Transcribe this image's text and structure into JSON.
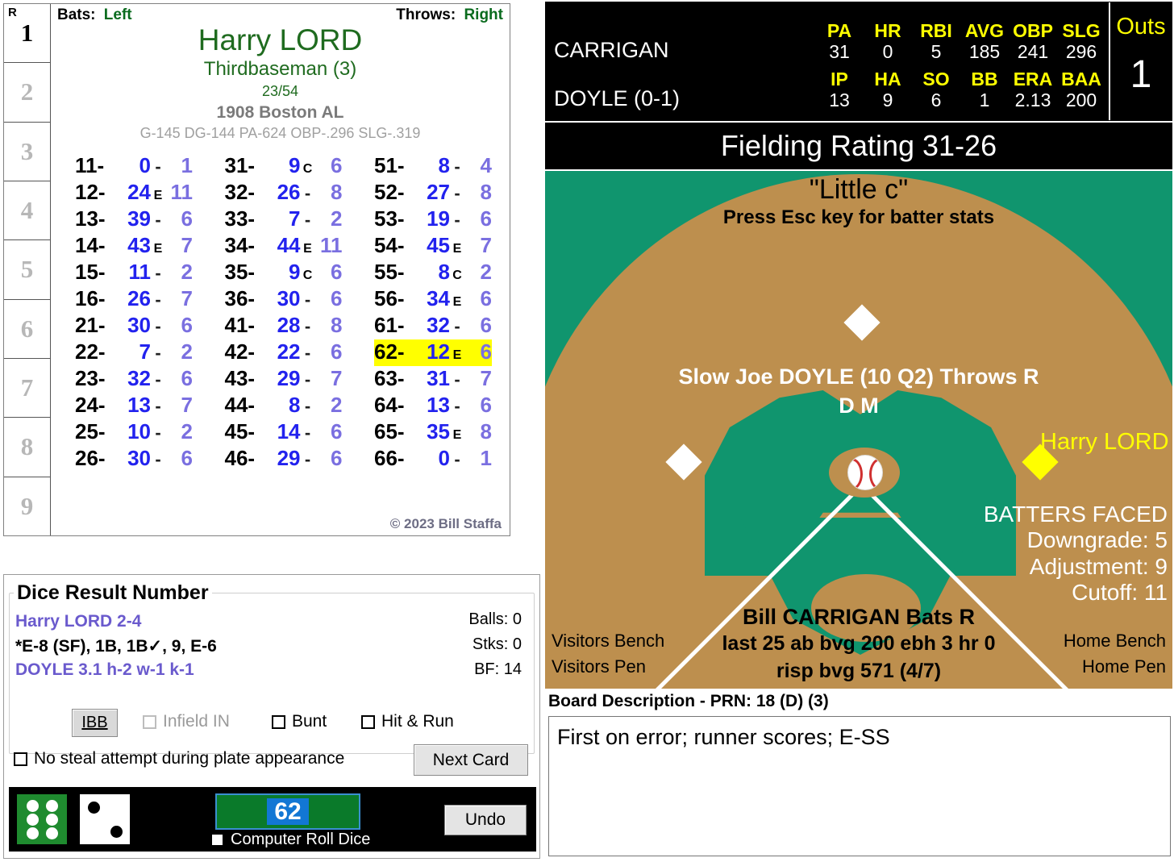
{
  "card": {
    "innings": [
      "1",
      "2",
      "3",
      "4",
      "5",
      "6",
      "7",
      "8",
      "9"
    ],
    "runs_label": "R",
    "bats_label": "Bats:",
    "bats_value": "Left",
    "throws_label": "Throws:",
    "throws_value": "Right",
    "player_name": "Harry LORD",
    "position": "Thirdbaseman (3)",
    "fraction": "23/54",
    "team_year": "1908 Boston AL",
    "stat_line": "G-145 DG-144 PA-624 OBP-.296 SLG-.319",
    "copyright": "© 2023 Bill Staffa",
    "highlight_key": "62-",
    "columns": [
      [
        {
          "key": "11-",
          "num": "0",
          "mid": "-",
          "tail": "1"
        },
        {
          "key": "12-",
          "num": "24",
          "mid": "E",
          "tail": "11"
        },
        {
          "key": "13-",
          "num": "39",
          "mid": "-",
          "tail": "6"
        },
        {
          "key": "14-",
          "num": "43",
          "mid": "E",
          "tail": "7"
        },
        {
          "key": "15-",
          "num": "11",
          "mid": "-",
          "tail": "2"
        },
        {
          "key": "16-",
          "num": "26",
          "mid": "-",
          "tail": "7"
        },
        {
          "key": "21-",
          "num": "30",
          "mid": "-",
          "tail": "6"
        },
        {
          "key": "22-",
          "num": "7",
          "mid": "-",
          "tail": "2"
        },
        {
          "key": "23-",
          "num": "32",
          "mid": "-",
          "tail": "6"
        },
        {
          "key": "24-",
          "num": "13",
          "mid": "-",
          "tail": "7"
        },
        {
          "key": "25-",
          "num": "10",
          "mid": "-",
          "tail": "2"
        },
        {
          "key": "26-",
          "num": "30",
          "mid": "-",
          "tail": "6"
        }
      ],
      [
        {
          "key": "31-",
          "num": "9",
          "mid": "C",
          "tail": "6"
        },
        {
          "key": "32-",
          "num": "26",
          "mid": "-",
          "tail": "8"
        },
        {
          "key": "33-",
          "num": "7",
          "mid": "-",
          "tail": "2"
        },
        {
          "key": "34-",
          "num": "44",
          "mid": "E",
          "tail": "11"
        },
        {
          "key": "35-",
          "num": "9",
          "mid": "C",
          "tail": "6"
        },
        {
          "key": "36-",
          "num": "30",
          "mid": "-",
          "tail": "6"
        },
        {
          "key": "41-",
          "num": "28",
          "mid": "-",
          "tail": "8"
        },
        {
          "key": "42-",
          "num": "22",
          "mid": "-",
          "tail": "6"
        },
        {
          "key": "43-",
          "num": "29",
          "mid": "-",
          "tail": "7"
        },
        {
          "key": "44-",
          "num": "8",
          "mid": "-",
          "tail": "2"
        },
        {
          "key": "45-",
          "num": "14",
          "mid": "-",
          "tail": "6"
        },
        {
          "key": "46-",
          "num": "29",
          "mid": "-",
          "tail": "6"
        }
      ],
      [
        {
          "key": "51-",
          "num": "8",
          "mid": "-",
          "tail": "4"
        },
        {
          "key": "52-",
          "num": "27",
          "mid": "-",
          "tail": "8"
        },
        {
          "key": "53-",
          "num": "19",
          "mid": "-",
          "tail": "6"
        },
        {
          "key": "54-",
          "num": "45",
          "mid": "E",
          "tail": "7"
        },
        {
          "key": "55-",
          "num": "8",
          "mid": "C",
          "tail": "2"
        },
        {
          "key": "56-",
          "num": "34",
          "mid": "E",
          "tail": "6"
        },
        {
          "key": "61-",
          "num": "32",
          "mid": "-",
          "tail": "6"
        },
        {
          "key": "62-",
          "num": "12",
          "mid": "E",
          "tail": "6"
        },
        {
          "key": "63-",
          "num": "31",
          "mid": "-",
          "tail": "7"
        },
        {
          "key": "64-",
          "num": "13",
          "mid": "-",
          "tail": "6"
        },
        {
          "key": "65-",
          "num": "35",
          "mid": "E",
          "tail": "8"
        },
        {
          "key": "66-",
          "num": "0",
          "mid": "-",
          "tail": "1"
        }
      ]
    ]
  },
  "dice_panel": {
    "title": "Dice Result Number",
    "batter_line": "Harry LORD  2-4",
    "result_line": "*E-8 (SF), 1B, 1B✓, 9, E-6",
    "pitcher_line": "DOYLE  3.1  h-2  w-1  k-1",
    "counts": {
      "balls_label": "Balls: 0",
      "strikes_label": "Stks: 0",
      "bf_label": "BF: 14"
    },
    "ibb_label": "IBB",
    "infield_in_label": "Infield IN",
    "bunt_label": "Bunt",
    "hit_run_label": "Hit & Run",
    "no_steal_label": "No steal attempt during plate appearance",
    "next_card_label": "Next Card",
    "roll_value": "62",
    "computer_roll_label": "Computer Roll Dice",
    "undo_label": "Undo",
    "die1_value": 6,
    "die2_value": 2,
    "die1_color": "#1f8b2f",
    "die2_color": "#ffffff"
  },
  "scoreboard": {
    "batter_name": "CARRIGAN",
    "pitcher_name": "DOYLE (0-1)",
    "batter_headers": [
      "PA",
      "HR",
      "RBI",
      "AVG",
      "OBP",
      "SLG"
    ],
    "batter_values": [
      "31",
      "0",
      "5",
      "185",
      "241",
      "296"
    ],
    "pitcher_headers": [
      "IP",
      "HA",
      "SO",
      "BB",
      "ERA",
      "BAA"
    ],
    "pitcher_values": [
      "13",
      "9",
      "6",
      "1",
      "2.13",
      "200"
    ],
    "outs_label": "Outs",
    "outs_value": "1",
    "fielding_rating": "Fielding Rating 31-26"
  },
  "field": {
    "park_name": "\"Little c\"",
    "esc_hint": "Press Esc key for batter stats",
    "pitcher_line": "Slow Joe DOYLE (10 Q2) Throws R",
    "pitcher_sub": "D M",
    "runner_name": "Harry LORD",
    "batters_faced_title": "BATTERS FACED",
    "downgrade": "Downgrade: 5",
    "adjustment": "Adjustment: 9",
    "cutoff": "Cutoff: 11",
    "batter_line1": "Bill CARRIGAN Bats R",
    "batter_line2": "last 25 ab bvg 200 ebh 3 hr 0",
    "batter_line3": "risp bvg 571 (4/7)",
    "visitors_bench": "Visitors Bench",
    "visitors_pen": "Visitors Pen",
    "home_bench": "Home Bench",
    "home_pen": "Home Pen"
  },
  "board": {
    "title": "Board Description - PRN: 18 (D) (3)",
    "text": "First on error; runner scores; E-SS"
  }
}
